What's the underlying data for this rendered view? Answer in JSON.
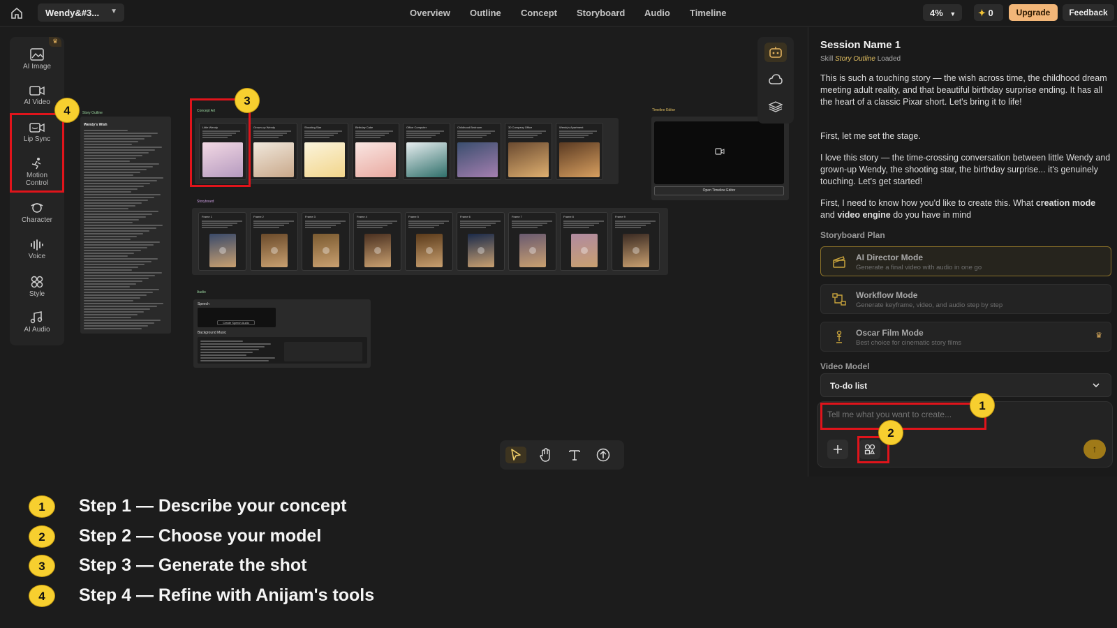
{
  "topbar": {
    "project_name": "Wendy&#3...",
    "nav_items": [
      "Overview",
      "Outline",
      "Concept",
      "Storyboard",
      "Audio",
      "Timeline"
    ],
    "zoom": "4%",
    "credits": "0",
    "upgrade_label": "Upgrade",
    "feedback_label": "Feedback"
  },
  "tools": [
    {
      "label": "AI Image",
      "icon": "image-icon"
    },
    {
      "label": "AI Video",
      "icon": "video-icon"
    },
    {
      "label": "Lip Sync",
      "icon": "lip-sync-icon"
    },
    {
      "label": "Motion Control",
      "icon": "motion-icon"
    },
    {
      "label": "Character",
      "icon": "character-icon"
    },
    {
      "label": "Voice",
      "icon": "voice-icon"
    },
    {
      "label": "Style",
      "icon": "style-icon"
    },
    {
      "label": "AI Audio",
      "icon": "audio-icon"
    }
  ],
  "canvas": {
    "story_outline_tag": "Story Outline",
    "story_outline_title": "Wendy's Wish",
    "concept_art_tag": "Concept Art",
    "concept_cards": [
      "Little Wendy",
      "Grown-up Wendy",
      "Shooting Star",
      "Birthday Cake",
      "Office Computer",
      "Childhood Bedroom",
      "30 Company Office",
      "Wendy's Apartment"
    ],
    "storyboard_tag": "Storyboard",
    "storyboard_frames": [
      "Frame 1",
      "Frame 2",
      "Frame 3",
      "Frame 4",
      "Frame 5",
      "Frame 6",
      "Frame 7",
      "Frame 8",
      "Frame 9"
    ],
    "timeline_tag": "Timeline Editor",
    "timeline_button": "Open Timeline Editor",
    "audio_tag": "Audio",
    "audio_speech": "Speech",
    "audio_speech_btn": "Create Speech Audio",
    "audio_bgm": "Background Music"
  },
  "right_panel": {
    "session_name": "Session Name 1",
    "skill_prefix": "Skill",
    "skill_name": "Story Outline",
    "skill_suffix": "Loaded",
    "para1": "This is such a touching story — the wish across time, the childhood dream meeting adult reality, and that beautiful birthday surprise ending. It has all the heart of a classic Pixar short. Let's bring it to life!",
    "para2": "First, let me set the stage.",
    "para3": "I love this story — the time-crossing conversation between little Wendy and grown-up Wendy, the shooting star, the birthday surprise... it's genuinely touching. Let's get started!",
    "para4_a": "First, I need to know how you'd like to create this. What ",
    "para4_b": "creation mode",
    "para4_c": " and ",
    "para4_d": "video engine",
    "para4_e": " do you have in mind",
    "storyboard_plan_label": "Storyboard Plan",
    "modes": [
      {
        "title": "AI Director Mode",
        "desc": "Generate a final video with audio in one go"
      },
      {
        "title": "Workflow Mode",
        "desc": "Generate keyframe, video, and audio step by step"
      },
      {
        "title": "Oscar Film Mode",
        "desc": "Best choice for cinematic story films"
      }
    ],
    "video_model_label": "Video Model",
    "video_model_value": "To-do list",
    "composer_placeholder": "Tell me what you want to create..."
  },
  "annotations": {
    "badges": [
      "1",
      "2",
      "3",
      "4"
    ]
  },
  "steps": [
    {
      "num": "1",
      "text": "Step 1 — Describe your concept"
    },
    {
      "num": "2",
      "text": "Step 2 — Choose your model"
    },
    {
      "num": "3",
      "text": "Step 3 — Generate the shot"
    },
    {
      "num": "4",
      "text": "Step 4 — Refine with Anijam's tools"
    }
  ],
  "colors": {
    "accent": "#f7cf2f",
    "highlight": "#e0141b",
    "upgrade": "#f2b678"
  }
}
